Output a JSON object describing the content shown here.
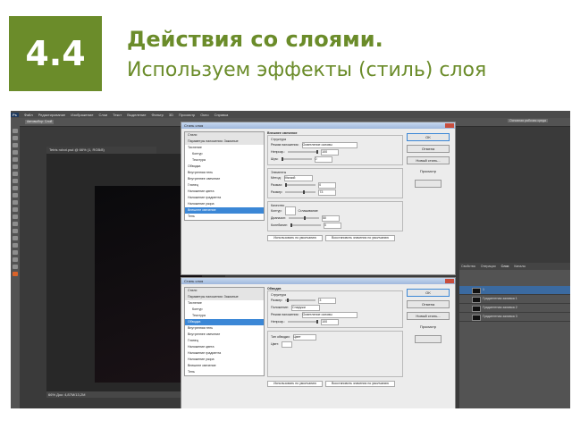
{
  "slide": {
    "number": "4.4",
    "title": "Действия со слоями.",
    "subtitle": "Используем эффекты (стиль) слоя"
  },
  "colors": {
    "accent": "#6b8c2a",
    "selection": "#3b87d6"
  },
  "photoshop": {
    "menu": [
      "Ps",
      "Файл",
      "Редактирование",
      "Изображение",
      "Слои",
      "Текст",
      "Выделение",
      "Фильтр",
      "3D",
      "Просмотр",
      "Окно",
      "Справка"
    ],
    "options": {
      "auto_select": "Автовыбор: Слой",
      "workspace": "Основная рабочая среда"
    },
    "doc_tab": "Tetris robot.psd @ 66% (1, RGB/8)",
    "status": "66%   Док: 4,87М/13,2М",
    "layers_panel": {
      "tabs": [
        "Свойства",
        "Операции",
        "Слои",
        "Каналы"
      ],
      "layers": [
        "1",
        "Градиентная заливка 1",
        "Градиентная заливка 2",
        "Градиентная заливка 3"
      ]
    },
    "dialog_bevel": {
      "title": "Стиль слоя",
      "styles": [
        "Стили",
        "Параметры наложения: Заказные",
        "Тиснение",
        "Контур",
        "Текстура",
        "Обводка",
        "Внутренняя тень",
        "Внутреннее свечение",
        "Глянец",
        "Наложение цвета",
        "Наложение градиента",
        "Наложение узора",
        "Внешнее свечение",
        "Тень"
      ],
      "selected": "Внешнее свечение",
      "section": "Внешнее свечение",
      "structure": "Структура",
      "blend_mode_label": "Режим наложения:",
      "blend_mode": "Осветление основы",
      "opacity_label": "Непрозр.:",
      "opacity": "100",
      "noise_label": "Шум:",
      "noise": "0",
      "elements": "Элементы",
      "method_label": "Метод:",
      "method": "Мягкий",
      "spread_label": "Размах:",
      "spread": "0",
      "size_label": "Размер:",
      "size": "73",
      "quality": "Качество",
      "contour_label": "Контур:",
      "antialias": "Сглаживание",
      "range_label": "Диапазон:",
      "range": "50",
      "jitter_label": "Колебание:",
      "jitter": "0",
      "default_btn": "Использовать по умолчанию",
      "reset_btn": "Восстановить значения по умолчанию",
      "buttons": [
        "OK",
        "Отмена",
        "Новый стиль...",
        "Просмотр"
      ]
    },
    "dialog_stroke": {
      "title": "Стиль слоя",
      "selected": "Обводка",
      "section": "Обводка",
      "structure": "Структура",
      "size_label": "Размер:",
      "size": "3",
      "position_label": "Положение:",
      "position": "Снаружи",
      "blend_mode_label": "Режим наложения:",
      "blend_mode": "Осветление основы",
      "opacity_label": "Непрозр.:",
      "opacity": "100",
      "fill_type_label": "Тип обводки:",
      "fill_type": "Цвет",
      "color_label": "Цвет:",
      "default_btn": "Использовать по умолчанию",
      "reset_btn": "Восстановить значения по умолчанию",
      "buttons": [
        "OK",
        "Отмена",
        "Новый стиль...",
        "Просмотр"
      ]
    }
  }
}
